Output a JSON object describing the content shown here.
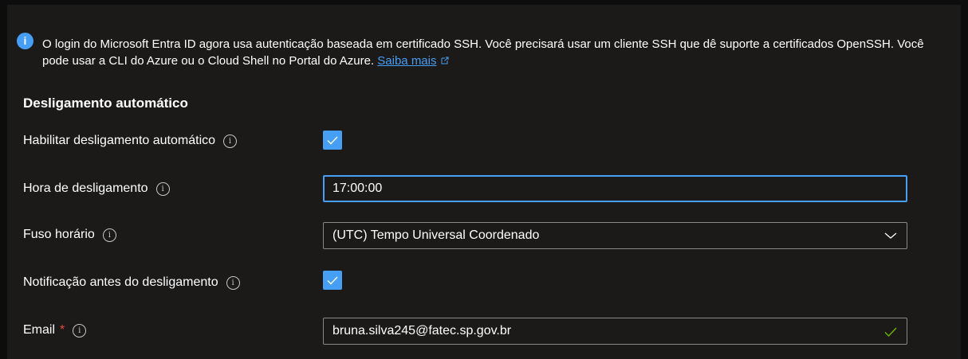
{
  "info": {
    "text": "O login do Microsoft Entra ID agora usa autenticação baseada em certificado SSH. Você precisará usar um cliente SSH que dê suporte a certificados OpenSSH. Você pode usar a CLI do Azure ou o Cloud Shell no Portal do Azure.",
    "link": "Saiba mais"
  },
  "section": {
    "title": "Desligamento automático"
  },
  "fields": {
    "enable_shutdown": {
      "label": "Habilitar desligamento automático",
      "checked": true
    },
    "shutdown_time": {
      "label": "Hora de desligamento",
      "value": "17:00:00"
    },
    "timezone": {
      "label": "Fuso horário",
      "value": "(UTC) Tempo Universal Coordenado"
    },
    "notification": {
      "label": "Notificação antes do desligamento",
      "checked": true
    },
    "email": {
      "label": "Email",
      "required_mark": "*",
      "value": "bruna.silva245@fatec.sp.gov.br"
    }
  },
  "colors": {
    "accent": "#479ef5",
    "background": "#1b1a19",
    "valid": "#6bb700",
    "required": "#e74c3c"
  }
}
